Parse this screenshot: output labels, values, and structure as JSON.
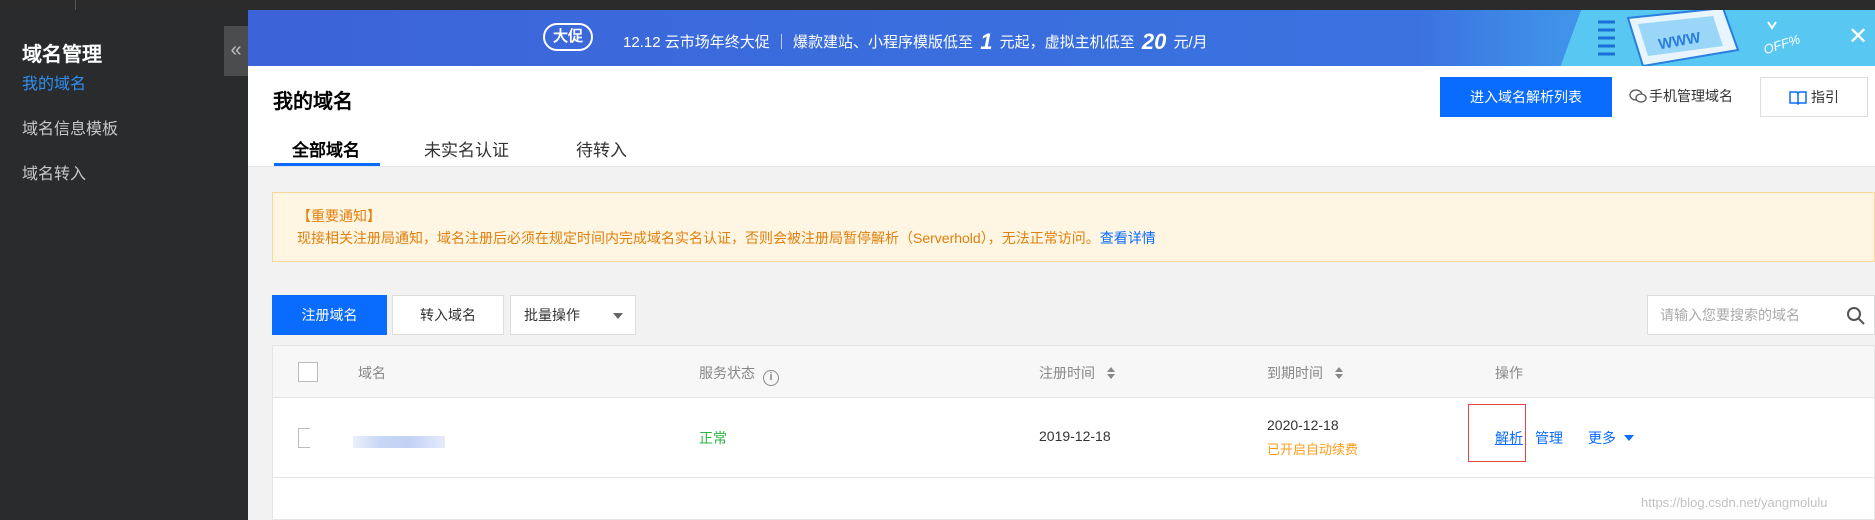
{
  "sidebar": {
    "title": "域名管理",
    "collapse_icon": "«",
    "items": [
      {
        "label": "我的域名",
        "active": true
      },
      {
        "label": "域名信息模板",
        "active": false
      },
      {
        "label": "域名转入",
        "active": false
      }
    ]
  },
  "banner": {
    "badge": "大促",
    "text_part1": "12.12 云市场年终大促 ｜ 爆款建站、小程序模版低至",
    "price1": "1",
    "text_part2": "元起，虚拟主机低至",
    "price2": "20",
    "text_part3": "元/月",
    "close": "✕",
    "colors": {
      "main": "#3c63d8",
      "accent": "#58c8f2"
    }
  },
  "header": {
    "title": "我的域名",
    "primary_button": "进入域名解析列表",
    "mobile_link": "手机管理域名",
    "guide_button": "指引",
    "tabs": [
      {
        "label": "全部域名",
        "active": true
      },
      {
        "label": "未实名认证",
        "active": false
      },
      {
        "label": "待转入",
        "active": false
      }
    ]
  },
  "notice": {
    "title": "【重要通知】",
    "text": "现接相关注册局通知，域名注册后必须在规定时间内完成域名实名认证，否则会被注册局暂停解析（Serverhold），无法正常访问。",
    "link": "查看详情"
  },
  "toolbar": {
    "register_button": "注册域名",
    "transfer_button": "转入域名",
    "batch_select": "批量操作",
    "search_placeholder": "请输入您要搜索的域名"
  },
  "table": {
    "columns": {
      "domain": "域名",
      "status": "服务状态",
      "reg_time": "注册时间",
      "expire_time": "到期时间",
      "actions": "操作"
    },
    "rows": [
      {
        "status": "正常",
        "reg_time": "2019-12-18",
        "expire_time": "2020-12-18",
        "renew_note": "已开启自动续费",
        "action_resolve": "解析",
        "action_manage": "管理",
        "action_more": "更多"
      }
    ]
  },
  "watermark": "https://blog.csdn.net/yangmolulu",
  "colors": {
    "brand_blue": "#0a6cff",
    "sidebar_bg": "#292b2d",
    "notice_orange": "#e0800c",
    "status_green": "#29b446"
  }
}
